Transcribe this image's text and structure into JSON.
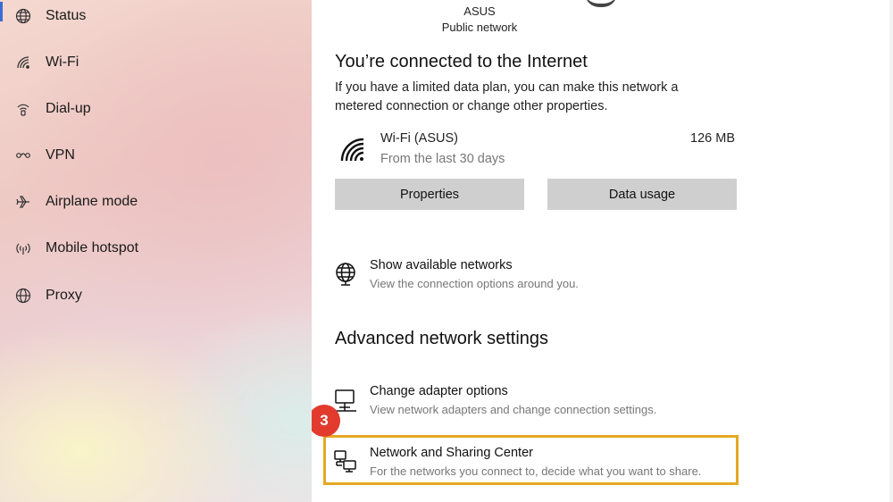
{
  "sidebar": {
    "items": [
      {
        "label": "Status",
        "icon": "globe-icon",
        "selected": true
      },
      {
        "label": "Wi-Fi",
        "icon": "wifi-icon"
      },
      {
        "label": "Dial-up",
        "icon": "dialup-icon"
      },
      {
        "label": "VPN",
        "icon": "vpn-icon"
      },
      {
        "label": "Airplane mode",
        "icon": "airplane-icon"
      },
      {
        "label": "Mobile hotspot",
        "icon": "hotspot-icon"
      },
      {
        "label": "Proxy",
        "icon": "globe-icon"
      }
    ]
  },
  "network": {
    "name": "ASUS",
    "type": "Public network"
  },
  "status": {
    "heading": "You’re connected to the Internet",
    "description": "If you have a limited data plan, you can make this network a metered connection or change other properties."
  },
  "usage": {
    "name": "Wi-Fi (ASUS)",
    "range": "From the last 30 days",
    "amount": "126 MB"
  },
  "buttons": {
    "properties": "Properties",
    "data_usage": "Data usage"
  },
  "show_networks": {
    "title": "Show available networks",
    "subtitle": "View the connection options around you."
  },
  "advanced": {
    "heading": "Advanced network settings",
    "adapter": {
      "title": "Change adapter options",
      "subtitle": "View network adapters and change connection settings."
    },
    "sharing": {
      "title": "Network and Sharing Center",
      "subtitle": "For the networks you connect to, decide what you want to share."
    }
  },
  "annotation": {
    "step": "3",
    "highlight_color": "#e6a823",
    "badge_color": "#e23b2e"
  },
  "colors": {
    "accent": "#3b6bd6",
    "button_bg": "#cfcfcf"
  }
}
